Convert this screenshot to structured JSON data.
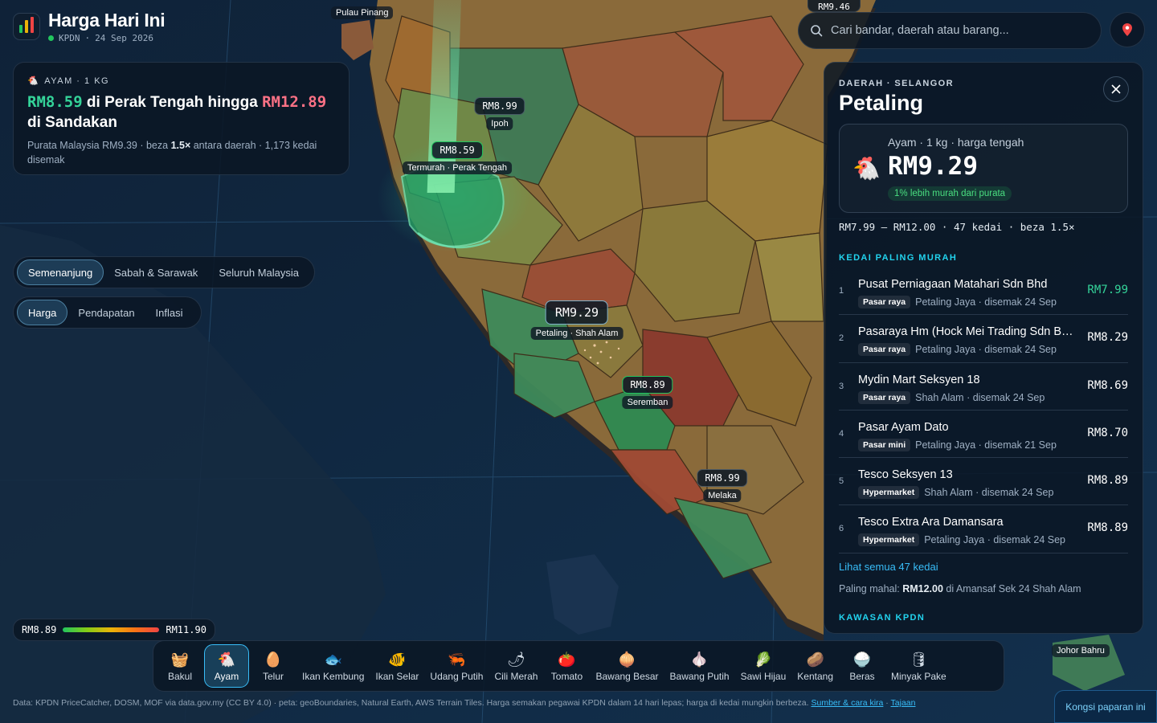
{
  "header": {
    "title": "Harga Hari Ini",
    "source": "KPDN",
    "date": "24 Sep 2026",
    "logo_colors": [
      "#22c55e",
      "#eab308",
      "#ef4444"
    ]
  },
  "summary": {
    "kicker": "AYAM · 1 KG",
    "low_price": "RM8.59",
    "mid_text": " di Perak Tengah hingga ",
    "high_price": "RM12.89",
    "end_text": " di Sandakan",
    "foot_prefix": "Purata Malaysia RM9.39 · beza ",
    "foot_ratio": "1.5×",
    "foot_suffix": " antara daerah · 1,173 kedai disemak"
  },
  "region_tabs": [
    "Semenanjung",
    "Sabah & Sarawak",
    "Seluruh Malaysia"
  ],
  "metric_tabs": [
    "Harga",
    "Pendapatan",
    "Inflasi"
  ],
  "map_labels": {
    "pulau_pinang": "Pulau Pinang",
    "ipoh_price": "RM8.99",
    "ipoh_place": "Ipoh",
    "cheapest_price": "RM8.59",
    "cheapest_place": "Termurah · Perak Tengah",
    "petaling_price": "RM9.29",
    "petaling_place": "Petaling · Shah Alam",
    "seremban_price": "RM8.89",
    "seremban_place": "Seremban",
    "melaka_price": "RM8.99",
    "melaka_place": "Melaka",
    "johor_place": "Johor Bahru",
    "top_badge": "RM9.46"
  },
  "search": {
    "placeholder": "Cari bandar, daerah atau barang..."
  },
  "detail": {
    "region": "DAERAH · SELANGOR",
    "title": "Petaling",
    "price_label": "Ayam · 1 kg · harga tengah",
    "price": "RM9.29",
    "pill": "1% lebih murah dari purata",
    "range": "RM7.99 – RM12.00 · 47 kedai · beza 1.5×",
    "cheapest_heading": "KEDAI PALING MURAH",
    "shops": [
      {
        "rank": "1",
        "name": "Pusat Perniagaan Matahari Sdn Bhd",
        "type": "Pasar raya",
        "meta": "Petaling Jaya · disemak 24 Sep",
        "price": "RM7.99"
      },
      {
        "rank": "2",
        "name": "Pasaraya Hm (Hock Mei Trading Sdn Bhd)",
        "type": "Pasar raya",
        "meta": "Petaling Jaya · disemak 24 Sep",
        "price": "RM8.29"
      },
      {
        "rank": "3",
        "name": "Mydin Mart Seksyen 18",
        "type": "Pasar raya",
        "meta": "Shah Alam · disemak 24 Sep",
        "price": "RM8.69"
      },
      {
        "rank": "4",
        "name": "Pasar Ayam Dato",
        "type": "Pasar mini",
        "meta": "Petaling Jaya · disemak 21 Sep",
        "price": "RM8.70"
      },
      {
        "rank": "5",
        "name": "Tesco Seksyen 13",
        "type": "Hypermarket",
        "meta": "Shah Alam · disemak 24 Sep",
        "price": "RM8.89"
      },
      {
        "rank": "6",
        "name": "Tesco Extra Ara Damansara",
        "type": "Hypermarket",
        "meta": "Petaling Jaya · disemak 24 Sep",
        "price": "RM8.89"
      }
    ],
    "see_all": "Lihat semua 47 kedai",
    "priciest_prefix": "Paling mahal: ",
    "priciest_price": "RM12.00",
    "priciest_suffix": " di Amansaf Sek 24 Shah Alam",
    "kpdn_heading": "KAWASAN KPDN"
  },
  "legend": {
    "min": "RM8.89",
    "max": "RM11.90"
  },
  "items": [
    {
      "label": "Bakul",
      "icon": "🧺"
    },
    {
      "label": "Ayam",
      "icon": "🐔"
    },
    {
      "label": "Telur",
      "icon": "🥚"
    },
    {
      "label": "Ikan Kembung",
      "icon": "🐟"
    },
    {
      "label": "Ikan Selar",
      "icon": "🐠"
    },
    {
      "label": "Udang Putih",
      "icon": "🦐"
    },
    {
      "label": "Cili Merah",
      "icon": "🌶"
    },
    {
      "label": "Tomato",
      "icon": "🍅"
    },
    {
      "label": "Bawang Besar",
      "icon": "🧅"
    },
    {
      "label": "Bawang Putih",
      "icon": "🧄"
    },
    {
      "label": "Sawi Hijau",
      "icon": "🥬"
    },
    {
      "label": "Kentang",
      "icon": "🥔"
    },
    {
      "label": "Beras",
      "icon": "🍚"
    },
    {
      "label": "Minyak Pake",
      "icon": "🛢"
    }
  ],
  "active_item": "Ayam",
  "footer": {
    "text": "Data: KPDN PriceCatcher, DOSM, MOF via data.gov.my (CC BY 4.0) · peta: geoBoundaries, Natural Earth, AWS Terrain Tiles. Harga semakan pegawai KPDN dalam 14 hari lepas; harga di kedai mungkin berbeza. ",
    "link1": "Sumber & cara kira",
    "sep": " · ",
    "link2": "Tajaan"
  },
  "share": "Kongsi paparan ini"
}
